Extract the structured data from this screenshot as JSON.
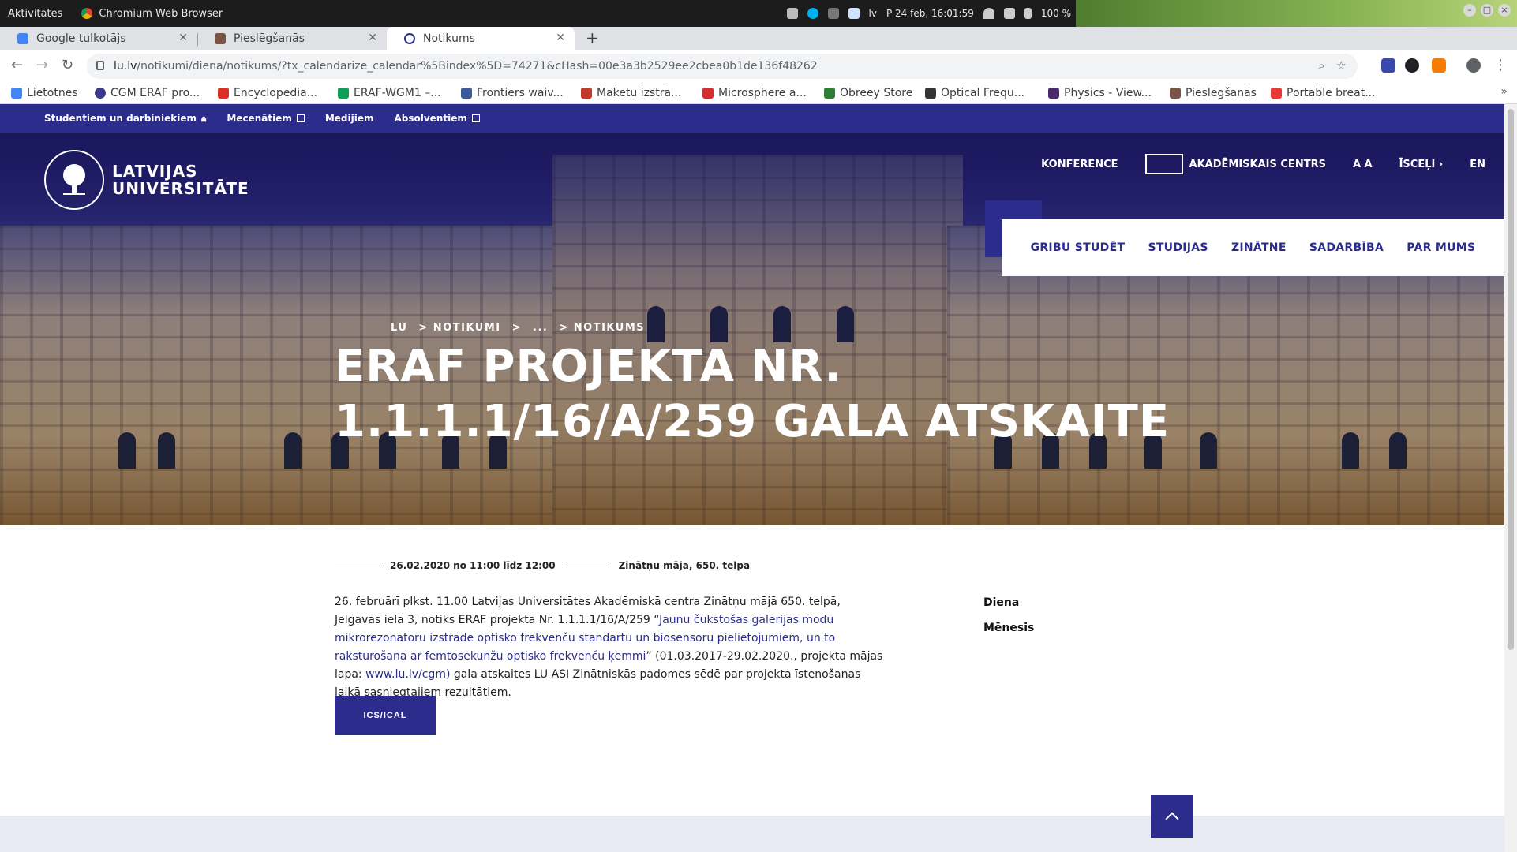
{
  "os": {
    "activities": "Aktivitātes",
    "app_name": "Chromium Web Browser",
    "keyboard_layout": "lv",
    "datetime": "P 24 feb, 16:01:59",
    "battery": "100 %"
  },
  "browser": {
    "tabs": [
      {
        "title": "Google tulkotājs",
        "active": false
      },
      {
        "title": "Pieslēgšanās",
        "active": false
      },
      {
        "title": "Notikums",
        "active": true
      }
    ],
    "url": {
      "host": "lu.lv",
      "path": "/notikumi/diena/notikums/?tx_calendarize_calendar%5Bindex%5D=74271&cHash=00e3a3b2529ee2cbea0b1de136f48262"
    },
    "bookmarks": [
      {
        "label": "Lietotnes",
        "color": "#4285f4"
      },
      {
        "label": "CGM ERAF pro...",
        "color": "#3a3a8c"
      },
      {
        "label": "Encyclopedia...",
        "color": "#d93025"
      },
      {
        "label": "ERAF-WGM1 –...",
        "color": "#0f9d58"
      },
      {
        "label": "Frontiers waiv...",
        "color": "#3b5998"
      },
      {
        "label": "Maketu izstrā...",
        "color": "#c0392b"
      },
      {
        "label": "Microsphere a...",
        "color": "#d32f2f"
      },
      {
        "label": "Obreey Store",
        "color": "#2e7d32"
      },
      {
        "label": "Optical Frequ...",
        "color": "#333333"
      },
      {
        "label": "Physics - View...",
        "color": "#4a2a6a"
      },
      {
        "label": "Pieslēgšanās",
        "color": "#795548"
      },
      {
        "label": "Portable breat...",
        "color": "#e53935"
      }
    ]
  },
  "site": {
    "utility_links": [
      {
        "label": "Studentiem un darbiniekiem",
        "icon": "lock-icon"
      },
      {
        "label": "Mecenātiem",
        "icon": "external-link-icon"
      },
      {
        "label": "Medijiem",
        "icon": ""
      },
      {
        "label": "Absolventiem",
        "icon": "external-link-icon"
      }
    ],
    "logo_line1": "LATVIJAS",
    "logo_line2": "UNIVERSITĀTE",
    "top_links": {
      "konference": "KONFERENCE",
      "akademiskais": "AKADĒMISKAIS CENTRS",
      "font_size": "A A",
      "shortcuts": "ĪSCEĻI",
      "lang": "EN"
    },
    "main_nav": [
      "GRIBU STUDĒT",
      "STUDIJAS",
      "ZINĀTNE",
      "SADARBĪBA",
      "PAR MUMS"
    ],
    "breadcrumb": [
      "LU",
      "> NOTIKUMI",
      ">",
      "...",
      "> NOTIKUMS"
    ],
    "title": "ERAF PROJEKTA NR. 1.1.1.1/16/A/259 GALA ATSKAITE",
    "event_datetime": "26.02.2020 no 11:00 līdz 12:00",
    "event_place": "Zinātņu māja, 650. telpa",
    "body": {
      "part1": "26. februārī plkst. 11.00 Latvijas Universitātes Akadēmiskā centra Zinātņu mājā 650. telpā, Jelgavas ielā 3, notiks ERAF projekta Nr. 1.1.1.1/16/A/259 “",
      "link1": "Jaunu čukstošās galerijas modu mikrorezonatoru izstrāde optisko frekvenču standartu un biosensoru pielietojumiem, un to raksturošana ar femtosekunžu optisko frekvenču ķemmi",
      "part2": "” (01.03.2017-29.02.2020., projekta mājas lapa: ",
      "link2": "www.lu.lv/cgm)",
      "part3": " gala atskaites LU ASI Zinātniskās padomes sēdē par projekta īstenošanas laikā sasniegtajiem rezultātiem."
    },
    "ics_button": "ICS/ICAL",
    "sidebar": [
      "Diena",
      "Mēnesis"
    ],
    "colors": {
      "brand": "#2c2c8c"
    }
  }
}
